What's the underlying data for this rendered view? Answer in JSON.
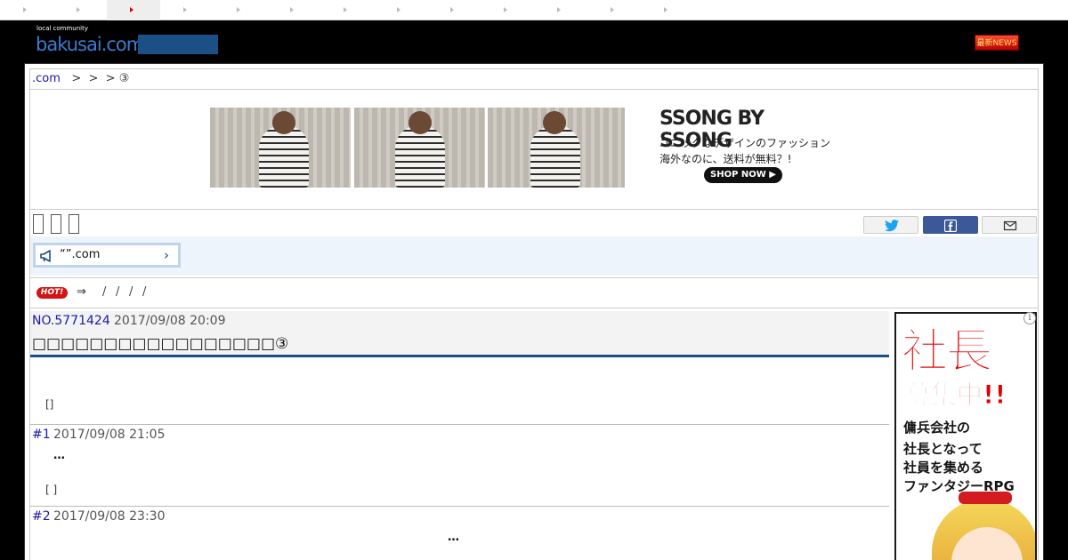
{
  "tabs": [
    {
      "id": "tab-1"
    },
    {
      "id": "tab-2",
      "active": true
    },
    {
      "id": "tab-3"
    },
    {
      "id": "tab-4"
    },
    {
      "id": "tab-5"
    },
    {
      "id": "tab-6"
    },
    {
      "id": "tab-7"
    },
    {
      "id": "tab-8"
    },
    {
      "id": "tab-9"
    },
    {
      "id": "tab-10"
    },
    {
      "id": "tab-11"
    },
    {
      "id": "tab-12"
    },
    {
      "id": "tab-13"
    }
  ],
  "header": {
    "logo_small": "local community",
    "logo_main": "bakusai.com",
    "news_label": "最新NEWS"
  },
  "breadcrumb": {
    "site": ".com",
    "sep1": ">",
    "sep2": ">",
    "sep3": ">",
    "current": "③"
  },
  "ad_banner": {
    "title": "SSONG BY SSONG",
    "line1": "ユニックなデザインのファッション",
    "line2": "海外なのに、送料が無料？!",
    "button": "SHOP NOW ▶"
  },
  "notice": {
    "text": "“”.com",
    "chevron": "›"
  },
  "hot": {
    "badge": "HOT!",
    "arrow": "⇒",
    "slashes": [
      "/",
      "/",
      "/",
      "/"
    ]
  },
  "thread": {
    "number": "NO.5771424",
    "date": "2017/09/08 20:09",
    "title": "□□□□□□□□□□□□□□□□□③",
    "meta": "[]"
  },
  "posts": [
    {
      "number": "#1",
      "date": "2017/09/08 21:05",
      "body": "…",
      "meta": "[ ]"
    },
    {
      "number": "#2",
      "date": "2017/09/08 23:30",
      "body": "…"
    }
  ],
  "side_ad": {
    "line1": "社長",
    "line2": "募集中!!",
    "line3": "傭兵会社の",
    "line4": "社長となって",
    "line5": "社員を集める",
    "line6": "ファンタジーRPG",
    "info": "i"
  },
  "colors": {
    "accent": "#1c4f86",
    "link": "#1a1aa6",
    "hot": "#d41414",
    "facebook": "#3b5998",
    "twitter": "#1da1f2"
  }
}
